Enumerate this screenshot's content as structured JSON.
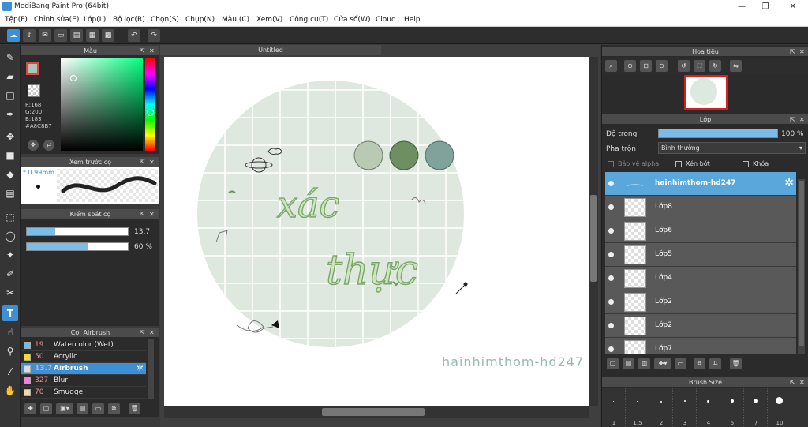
{
  "window": {
    "title": "MediBang Paint Pro (64bit)",
    "controls": [
      "—",
      "❐",
      "✕"
    ]
  },
  "menu": [
    "Tệp(F)",
    "Chỉnh sửa(E)",
    "Lớp(L)",
    "Bộ lọc(R)",
    "Chọn(S)",
    "Chụp(N)",
    "Màu (C)",
    "Xem(V)",
    "Công cụ(T)",
    "Cửa sổ(W)",
    "Cloud",
    "Help"
  ],
  "color_panel": {
    "title": "Màu",
    "r": "R:168",
    "g": "G:200",
    "b": "B:183",
    "hex": "#A8C8B7",
    "current_color": "#a8c8b7"
  },
  "brush_preview": {
    "title": "Xem trước cọ",
    "size": "* 0.99mm"
  },
  "brush_control": {
    "title": "Kiểm soát cọ",
    "size_value": "13.7",
    "size_fraction": 0.28,
    "opacity_value": "60 %",
    "opacity_fraction": 0.6
  },
  "brush_list": {
    "title": "Cọ: Airbrush",
    "items": [
      {
        "size": "19",
        "name": "Watercolor (Wet)",
        "color": "#6fc0e8"
      },
      {
        "size": "50",
        "name": "Acrylic",
        "color": "#f0e020"
      },
      {
        "size": "13.7",
        "name": "Airbrush",
        "color": "#dddddd"
      },
      {
        "size": "327",
        "name": "Blur",
        "color": "#f080e0"
      },
      {
        "size": "70",
        "name": "Smudge",
        "color": "#f5d8b0"
      }
    ]
  },
  "canvas": {
    "tab": "Untitled",
    "text_line1": "xác",
    "text_line2": "thực",
    "watermark": "hainhimthom-hd247"
  },
  "navigator": {
    "title": "Hoa tiêu"
  },
  "layers": {
    "title": "Lớp",
    "opacity_label": "Độ trong",
    "opacity_value": "100 %",
    "opacity_fraction": 1.0,
    "blend_label": "Pha trộn",
    "blend_value": "Bình thường",
    "protect_alpha": "Bảo vệ alpha",
    "clipping": "Xén bớt",
    "lock": "Khóa",
    "items": [
      "hainhimthom-hd247",
      "Lớp8",
      "Lớp6",
      "Lớp5",
      "Lớp4",
      "Lớp2",
      "Lớp2",
      "Lớp7"
    ]
  },
  "brush_size": {
    "title": "Brush Size",
    "sizes": [
      "1",
      "1.5",
      "2",
      "3",
      "4",
      "5",
      "7",
      "10"
    ]
  }
}
